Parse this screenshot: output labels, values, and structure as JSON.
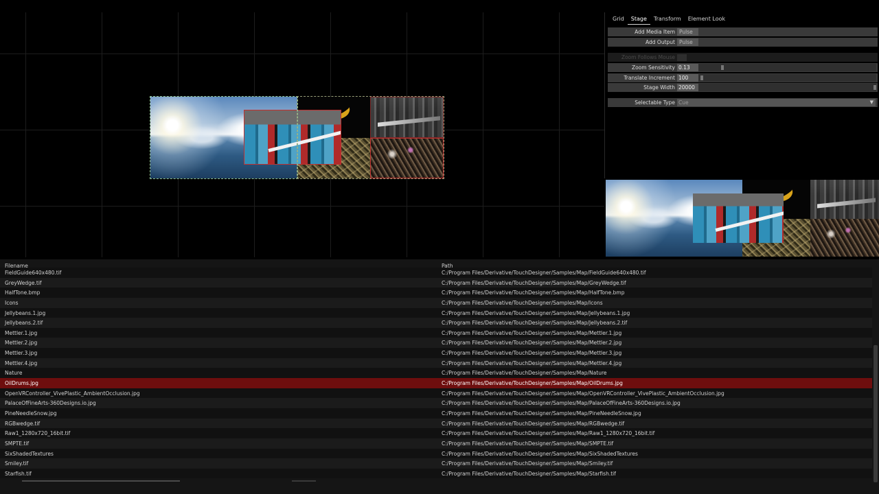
{
  "tabs": [
    {
      "label": "Grid",
      "active": false
    },
    {
      "label": "Stage",
      "active": true
    },
    {
      "label": "Transform",
      "active": false
    },
    {
      "label": "Element Look",
      "active": false
    }
  ],
  "params": {
    "add_media_item": {
      "label": "Add Media Item",
      "button": "Pulse"
    },
    "add_output": {
      "label": "Add Output",
      "button": "Pulse"
    },
    "zoom_follows_mouse": {
      "label": "Zoom Follows Mouse",
      "enabled": false
    },
    "zoom_sensitivity": {
      "label": "Zoom Sensitivity",
      "value": "0.13",
      "slider_fraction": 0.13
    },
    "translate_increment": {
      "label": "Translate Increment",
      "value": "100",
      "slider_fraction": 0.01
    },
    "stage_width": {
      "label": "Stage Width",
      "value": "20000",
      "slider_fraction": 1.0
    },
    "selectable_type": {
      "label": "Selectable Type",
      "value": "Cue"
    }
  },
  "icons": {
    "dropdown": "chevron-down-icon"
  },
  "colors": {
    "selected_row": "#6e0e0e",
    "selection_outline_red": "#c03030",
    "selection_outline_dashed": "#8fbf8f",
    "panel_row": "#3a3a3a"
  },
  "file_list": {
    "headers": {
      "filename": "Filename",
      "path": "Path"
    },
    "rows": [
      {
        "filename": "FieldGuide640x480.tif",
        "path": "C:/Program Files/Derivative/TouchDesigner/Samples/Map/FieldGuide640x480.tif"
      },
      {
        "filename": "GreyWedge.tif",
        "path": "C:/Program Files/Derivative/TouchDesigner/Samples/Map/GreyWedge.tif"
      },
      {
        "filename": "HalfTone.bmp",
        "path": "C:/Program Files/Derivative/TouchDesigner/Samples/Map/HalfTone.bmp"
      },
      {
        "filename": "Icons",
        "path": "C:/Program Files/Derivative/TouchDesigner/Samples/Map/Icons"
      },
      {
        "filename": "Jellybeans.1.jpg",
        "path": "C:/Program Files/Derivative/TouchDesigner/Samples/Map/Jellybeans.1.jpg"
      },
      {
        "filename": "Jellybeans.2.tif",
        "path": "C:/Program Files/Derivative/TouchDesigner/Samples/Map/Jellybeans.2.tif"
      },
      {
        "filename": "Mettler.1.jpg",
        "path": "C:/Program Files/Derivative/TouchDesigner/Samples/Map/Mettler.1.jpg"
      },
      {
        "filename": "Mettler.2.jpg",
        "path": "C:/Program Files/Derivative/TouchDesigner/Samples/Map/Mettler.2.jpg"
      },
      {
        "filename": "Mettler.3.jpg",
        "path": "C:/Program Files/Derivative/TouchDesigner/Samples/Map/Mettler.3.jpg"
      },
      {
        "filename": "Mettler.4.jpg",
        "path": "C:/Program Files/Derivative/TouchDesigner/Samples/Map/Mettler.4.jpg"
      },
      {
        "filename": "Nature",
        "path": "C:/Program Files/Derivative/TouchDesigner/Samples/Map/Nature"
      },
      {
        "filename": "OilDrums.jpg",
        "path": "C:/Program Files/Derivative/TouchDesigner/Samples/Map/OilDrums.jpg",
        "selected": true
      },
      {
        "filename": "OpenVRController_VivePlastic_AmbientOcclusion.jpg",
        "path": "C:/Program Files/Derivative/TouchDesigner/Samples/Map/OpenVRController_VivePlastic_AmbientOcclusion.jpg"
      },
      {
        "filename": "PalaceOfFineArts-360Designs.io.jpg",
        "path": "C:/Program Files/Derivative/TouchDesigner/Samples/Map/PalaceOfFineArts-360Designs.io.jpg"
      },
      {
        "filename": "PineNeedleSnow.jpg",
        "path": "C:/Program Files/Derivative/TouchDesigner/Samples/Map/PineNeedleSnow.jpg"
      },
      {
        "filename": "RGBwedge.tif",
        "path": "C:/Program Files/Derivative/TouchDesigner/Samples/Map/RGBwedge.tif"
      },
      {
        "filename": "Raw1_1280x720_16bit.tif",
        "path": "C:/Program Files/Derivative/TouchDesigner/Samples/Map/Raw1_1280x720_16bit.tif"
      },
      {
        "filename": "SMPTE.tif",
        "path": "C:/Program Files/Derivative/TouchDesigner/Samples/Map/SMPTE.tif"
      },
      {
        "filename": "SixShadedTextures",
        "path": "C:/Program Files/Derivative/TouchDesigner/Samples/Map/SixShadedTextures"
      },
      {
        "filename": "Smiley.tif",
        "path": "C:/Program Files/Derivative/TouchDesigner/Samples/Map/Smiley.tif"
      },
      {
        "filename": "Starfish.tif",
        "path": "C:/Program Files/Derivative/TouchDesigner/Samples/Map/Starfish.tif"
      }
    ]
  }
}
